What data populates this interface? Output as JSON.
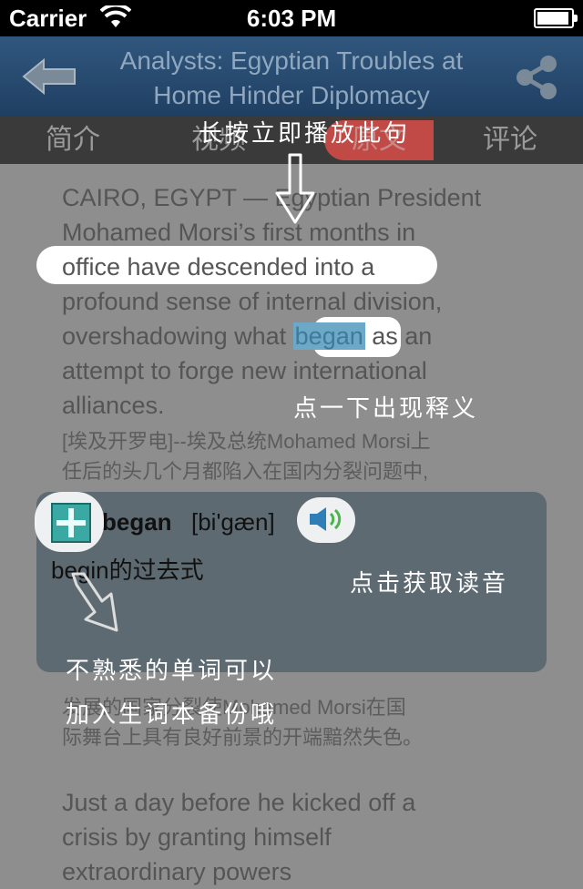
{
  "status_bar": {
    "carrier": "Carrier",
    "time": "6:03 PM"
  },
  "nav": {
    "title": "Analysts: Egyptian Troubles at Home Hinder Diplomacy"
  },
  "tabs": [
    {
      "label": "简介"
    },
    {
      "label": "视频"
    },
    {
      "label": "原文"
    },
    {
      "label": "评论"
    }
  ],
  "article": {
    "p1_lines": [
      "CAIRO, EGYPT — Egyptian President",
      "Mohamed Morsi’s first months in",
      "office have descended into a",
      "profound sense of internal division,"
    ],
    "p1_l5_before": "overshadowing what ",
    "p1_highlight": "began",
    "p1_l5_after": " as an",
    "p1_lines_end": [
      "attempt to forge new international",
      "alliances."
    ],
    "zh1_lines": [
      "[埃及开罗电]--埃及总统Mohamed Morsi上",
      "任后的头几个月都陷入在国内分裂问题中,"
    ],
    "zh2_lines": [
      "发展的国家分裂使Mohamed Morsi在国",
      "际舞台上具有良好前景的开端黯然失色。"
    ],
    "p2_lines": [
      "Just a day before he kicked off a",
      "crisis by granting himself",
      "extraordinary powers"
    ]
  },
  "popup": {
    "word": "began",
    "phonetic": "[bi'gæn]",
    "definition": "begin的过去式"
  },
  "annotations": {
    "long_press": "长按立即播放此句",
    "tap_definition": "点一下出现释义",
    "tap_sound": "点击获取读音",
    "add_word_line1": "不熟悉的单词可以",
    "add_word_line2": "加入生词本备份哦"
  },
  "colors": {
    "navbar": "#2a4d73",
    "active_tab": "#c24a46",
    "highlight": "#6da8c6",
    "overlay": "#8e8e8e"
  },
  "icons": [
    "wifi-icon",
    "battery-icon",
    "back-arrow-icon",
    "share-icon",
    "plus-icon",
    "speaker-icon",
    "hint-arrow-icon"
  ]
}
